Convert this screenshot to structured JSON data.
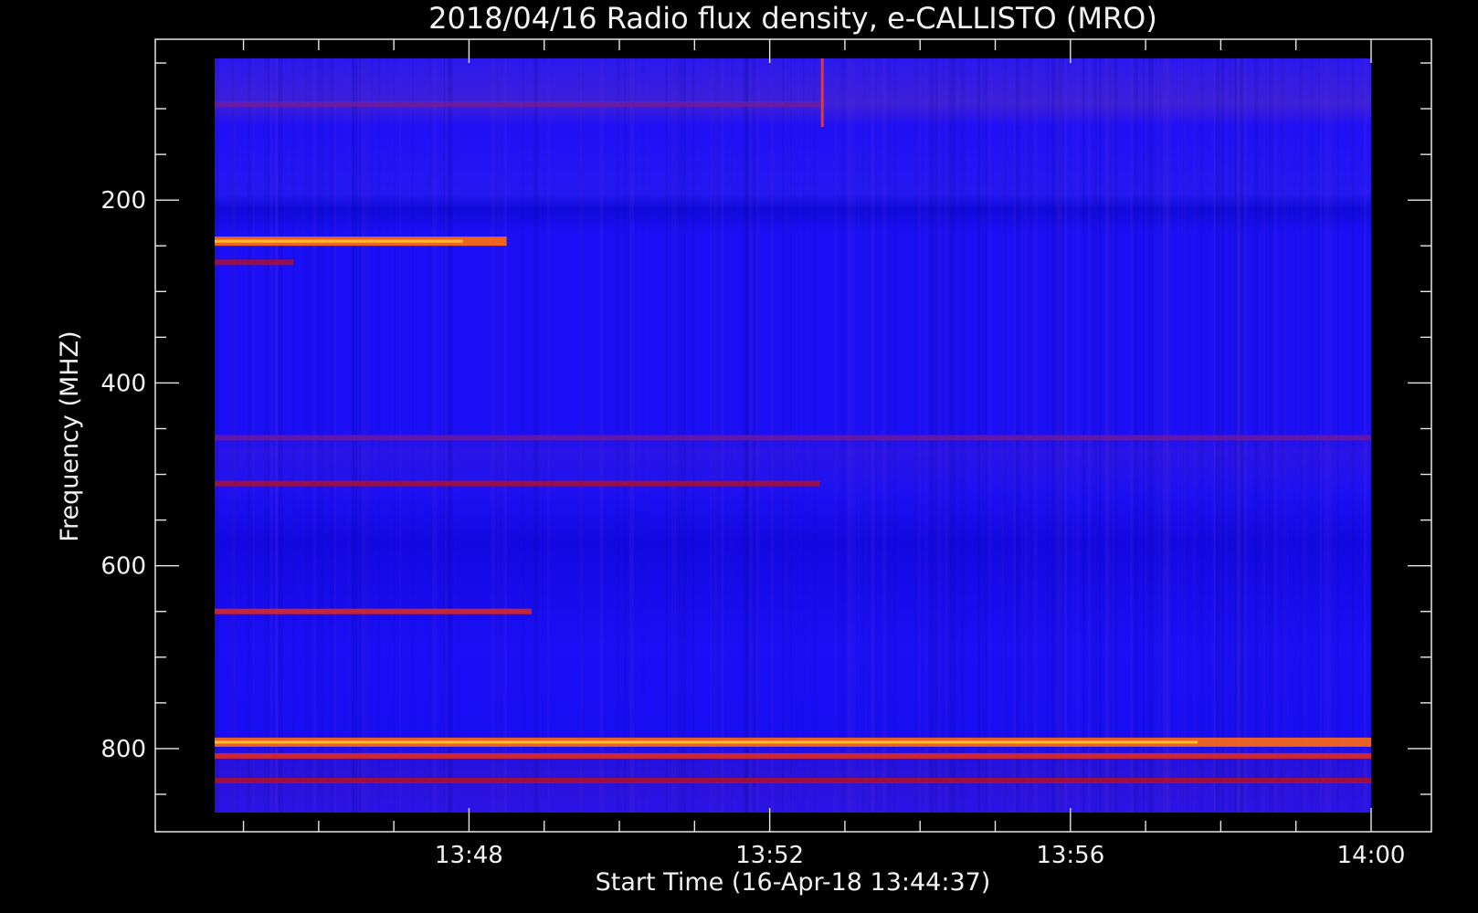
{
  "chart_data": {
    "type": "heatmap",
    "title": "2018/04/16  Radio flux density, e-CALLISTO (MRO)",
    "xlabel": "Start Time (16-Apr-18 13:44:37)",
    "ylabel": "Frequency (MHZ)",
    "x_axis": {
      "tick_labels": [
        "13:48",
        "13:52",
        "13:56",
        "14:00"
      ],
      "data_range": [
        "13:44:37",
        "14:00:00"
      ]
    },
    "y_axis": {
      "tick_labels": [
        "200",
        "400",
        "600",
        "800"
      ],
      "inverted": true,
      "data_range": [
        45,
        870
      ]
    },
    "colormap": [
      "#000000",
      "#0000ff",
      "#2222ee",
      "#cc1111",
      "#ff4400",
      "#ffee00"
    ],
    "background_color": "#000000",
    "grid": false,
    "legend": "none",
    "features": [
      {
        "kind": "band",
        "freq": 245,
        "t_start": "13:44:37",
        "t_end": "13:48:30",
        "intensity": 0.95
      },
      {
        "kind": "band",
        "freq": 268,
        "t_start": "13:44:37",
        "t_end": "13:45:40",
        "intensity": 0.6
      },
      {
        "kind": "band",
        "freq": 95,
        "t_start": "13:44:37",
        "t_end": "13:52:40",
        "intensity": 0.45
      },
      {
        "kind": "band",
        "freq": 460,
        "t_start": "13:44:37",
        "t_end": "14:00:00",
        "intensity": 0.55
      },
      {
        "kind": "band",
        "freq": 510,
        "t_start": "13:44:37",
        "t_end": "13:52:40",
        "intensity": 0.6
      },
      {
        "kind": "band",
        "freq": 650,
        "t_start": "13:44:37",
        "t_end": "13:48:50",
        "intensity": 0.75
      },
      {
        "kind": "band",
        "freq": 793,
        "t_start": "13:44:37",
        "t_end": "14:00:00",
        "intensity": 0.9
      },
      {
        "kind": "band",
        "freq": 808,
        "t_start": "13:44:37",
        "t_end": "14:00:00",
        "intensity": 0.8
      },
      {
        "kind": "band",
        "freq": 835,
        "t_start": "13:44:37",
        "t_end": "14:00:00",
        "intensity": 0.6
      },
      {
        "kind": "spike",
        "time": "13:52:42",
        "freq_start": 45,
        "freq_end": 120,
        "intensity": 0.9
      }
    ]
  }
}
